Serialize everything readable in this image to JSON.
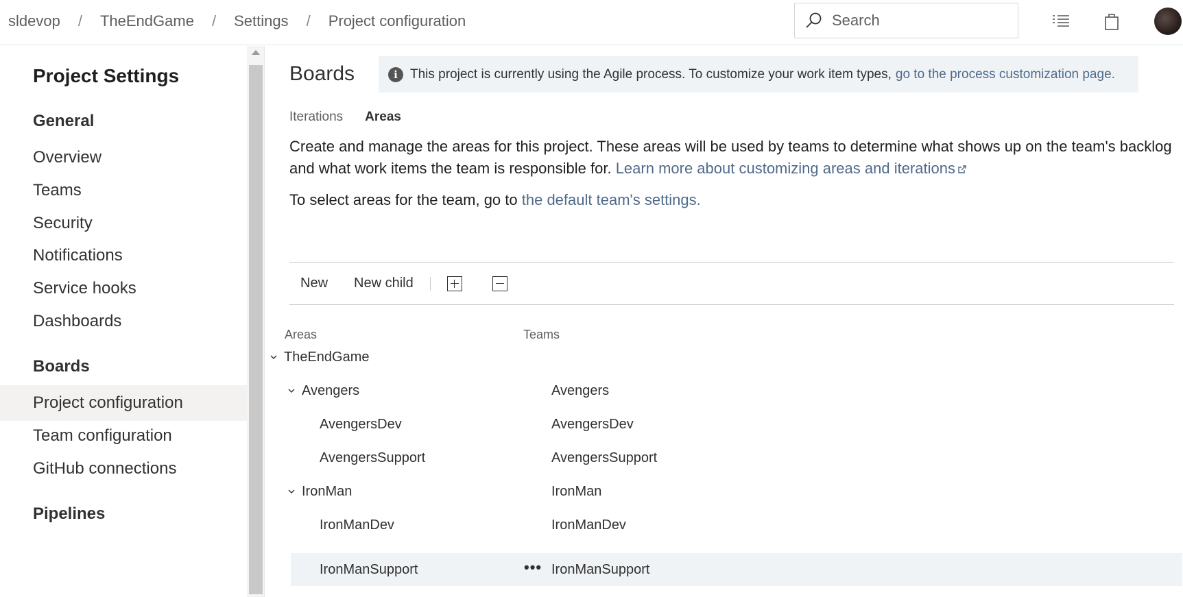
{
  "breadcrumb": [
    "sldevop",
    "TheEndGame",
    "Settings",
    "Project configuration"
  ],
  "breadcrumb_separator": "/",
  "search": {
    "placeholder": "Search"
  },
  "sidebar": {
    "title": "Project Settings",
    "sections": {
      "general": "General",
      "boards": "Boards",
      "pipelines": "Pipelines"
    },
    "general_items": [
      "Overview",
      "Teams",
      "Security",
      "Notifications",
      "Service hooks",
      "Dashboards"
    ],
    "boards_items": [
      "Project configuration",
      "Team configuration",
      "GitHub connections"
    ],
    "selected": "Project configuration"
  },
  "main": {
    "title": "Boards",
    "banner": {
      "text": "This project is currently using the Agile process. To customize your work item types,",
      "link": "go to the process customization page."
    },
    "tabs": [
      "Iterations",
      "Areas"
    ],
    "active_tab": "Areas",
    "description": {
      "text": "Create and manage the areas for this project. These areas will be used by teams to determine what shows up on the team's backlog and what work items the team is responsible for.",
      "link": "Learn more about customizing areas and iterations"
    },
    "select_text": {
      "text": "To select areas for the team, go to",
      "link": "the default team's settings."
    },
    "toolbar": {
      "new_label": "New",
      "new_child_label": "New child"
    },
    "columns": {
      "areas": "Areas",
      "teams": "Teams"
    },
    "rows": [
      {
        "area": "TheEndGame",
        "team": "",
        "level": 0,
        "expandable": true
      },
      {
        "area": "Avengers",
        "team": "Avengers",
        "level": 1,
        "expandable": true
      },
      {
        "area": "AvengersDev",
        "team": "AvengersDev",
        "level": 2,
        "expandable": false
      },
      {
        "area": "AvengersSupport",
        "team": "AvengersSupport",
        "level": 2,
        "expandable": false
      },
      {
        "area": "IronMan",
        "team": "IronMan",
        "level": 1,
        "expandable": true
      },
      {
        "area": "IronManDev",
        "team": "IronManDev",
        "level": 2,
        "expandable": false
      },
      {
        "area": "IronManSupport",
        "team": "IronManSupport",
        "level": 2,
        "expandable": false,
        "selected": true,
        "more": "•••"
      }
    ]
  }
}
